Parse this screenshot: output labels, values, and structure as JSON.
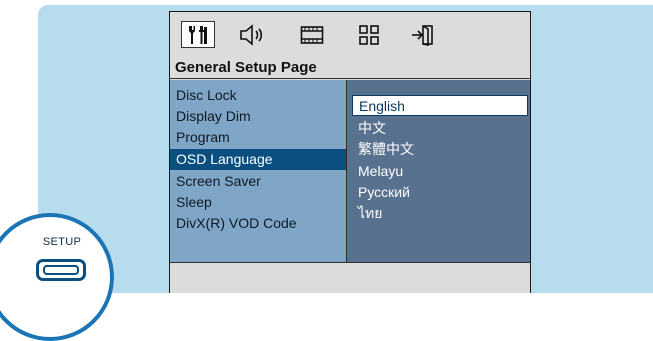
{
  "header": {
    "title": "General Setup Page"
  },
  "tabs": [
    {
      "icon": "settings-tools-icon",
      "active": true
    },
    {
      "icon": "speaker-icon",
      "active": false
    },
    {
      "icon": "video-film-icon",
      "active": false
    },
    {
      "icon": "grid-icon",
      "active": false
    },
    {
      "icon": "exit-icon",
      "active": false
    }
  ],
  "menu": {
    "items": [
      {
        "label": "Disc Lock"
      },
      {
        "label": "Display Dim"
      },
      {
        "label": "Program"
      },
      {
        "label": "OSD Language"
      },
      {
        "label": "Screen Saver"
      },
      {
        "label": "Sleep"
      },
      {
        "label": "DivX(R) VOD Code"
      }
    ],
    "selected_index": 3
  },
  "options": {
    "items": [
      {
        "label": "English"
      },
      {
        "label": "中文"
      },
      {
        "label": "繁體中文"
      },
      {
        "label": "Melayu"
      },
      {
        "label": "Русский"
      },
      {
        "label": "ไทย"
      }
    ],
    "selected_index": 0
  },
  "remote": {
    "setup_label": "SETUP"
  },
  "colors": {
    "background": "#b7dcee",
    "menu_bg": "#7fa6c7",
    "menu_selected": "#0b4f80",
    "options_bg": "#57718f",
    "panel_gray": "#dcdcdc"
  }
}
